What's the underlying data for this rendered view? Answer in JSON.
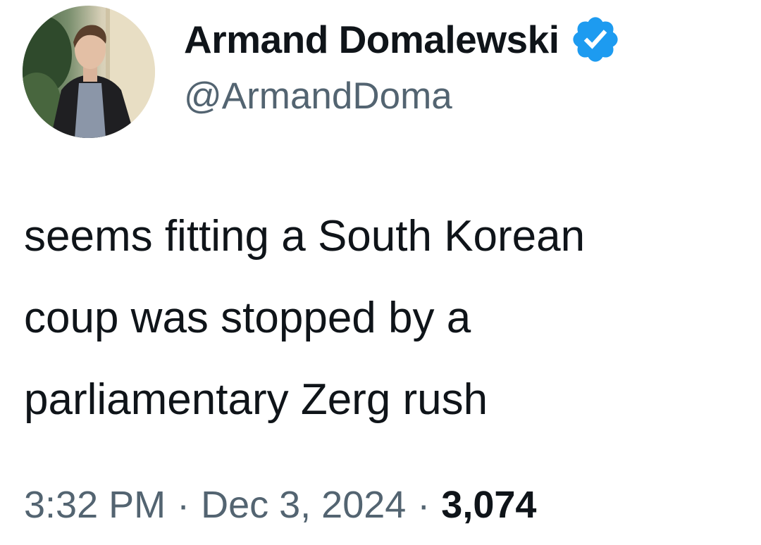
{
  "author": {
    "display_name": "Armand Domalewski",
    "handle": "@ArmandDoma",
    "verified": true,
    "avatar": "profile-photo"
  },
  "tweet": {
    "text": "seems fitting a South Korean\ncoup was stopped by a\nparliamentary Zerg rush",
    "time": "3:32 PM",
    "date": "Dec 3, 2024",
    "separator": "·",
    "views": "3,074"
  },
  "colors": {
    "text_primary": "#0f1419",
    "text_secondary": "#536471",
    "verified_badge": "#1d9bf0",
    "background": "#ffffff"
  },
  "icons": {
    "verified": "verified-badge-icon"
  }
}
